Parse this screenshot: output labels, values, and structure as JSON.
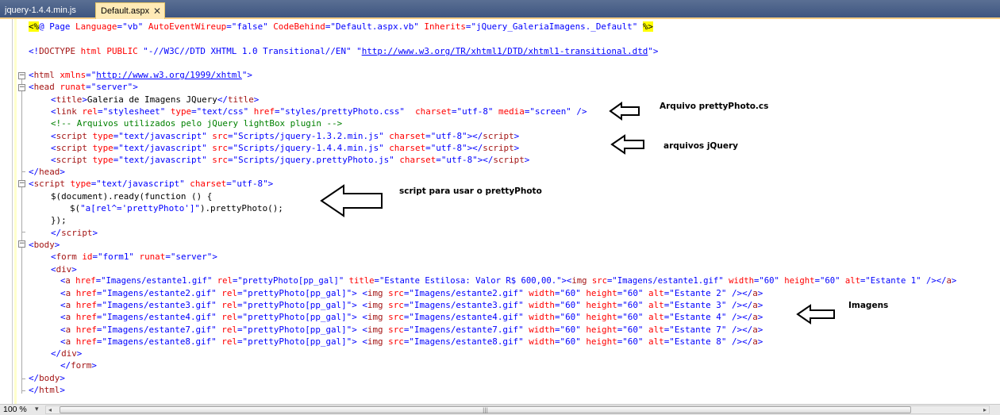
{
  "tabs": [
    {
      "label": "jquery-1.4.4.min.js",
      "active": false
    },
    {
      "label": "Default.aspx",
      "active": true
    }
  ],
  "tab_close_glyph": "✕",
  "code": {
    "l01": {
      "a": "<%",
      "b": "@ Page ",
      "c": "Language",
      "d": "=",
      "e": "\"vb\"",
      "f": " ",
      "g": "AutoEventWireup",
      "h": "=",
      "i": "\"false\"",
      "j": " ",
      "k": "CodeBehind",
      "l": "=",
      "m": "\"Default.aspx.vb\"",
      "n": " ",
      "o": "Inherits",
      "p": "=",
      "q": "\"jQuery_GaleriaImagens._Default\"",
      "r": " ",
      "s": "%>"
    },
    "l02": {
      "a": "<!",
      "b": "DOCTYPE",
      "c": " ",
      "d": "html",
      "e": " ",
      "f": "PUBLIC",
      "g": " \"-//W3C//DTD XHTML 1.0 Transitional//EN\" \"",
      "h": "http://www.w3.org/TR/xhtml1/DTD/xhtml1-transitional.dtd",
      "i": "\">"
    },
    "l03": {
      "a": "<",
      "b": "html",
      "c": " ",
      "d": "xmlns",
      "e": "=\"",
      "f": "http://www.w3.org/1999/xhtml",
      "g": "\">"
    },
    "l04": {
      "a": "<",
      "b": "head",
      "c": " ",
      "d": "runat",
      "e": "=",
      "f": "\"server\"",
      "g": ">"
    },
    "l05": {
      "a": "<",
      "b": "title",
      "c": ">",
      "d": "Galeria de Imagens JQuery",
      "e": "</",
      "f": "title",
      "g": ">"
    },
    "l06": {
      "a": "<",
      "b": "link",
      "c": " ",
      "d": "rel",
      "e": "=",
      "f": "\"stylesheet\"",
      "g": " ",
      "h": "type",
      "i": "=",
      "j": "\"text/css\"",
      "k": " ",
      "l": "href",
      "m": "=",
      "n": "\"styles/prettyPhoto.css\"",
      "o": "  ",
      "p": "charset",
      "q": "=",
      "r": "\"utf-8\"",
      "s": " ",
      "t": "media",
      "u": "=",
      "v": "\"screen\"",
      "w": " />"
    },
    "l07": {
      "a": "<!-- Arquivos utilizados pelo jQuery lightBox plugin -->"
    },
    "l08": {
      "a": "<",
      "b": "script",
      "c": " ",
      "d": "type",
      "e": "=",
      "f": "\"text/javascript\"",
      "g": " ",
      "h": "src",
      "i": "=",
      "j": "\"Scripts/jquery-1.3.2.min.js\"",
      "k": " ",
      "l": "charset",
      "m": "=",
      "n": "\"utf-8\"",
      "o": "></",
      "p": "script",
      "q": ">"
    },
    "l09": {
      "a": "<",
      "b": "script",
      "c": " ",
      "d": "type",
      "e": "=",
      "f": "\"text/javascript\"",
      "g": " ",
      "h": "src",
      "i": "=",
      "j": "\"Scripts/jquery-1.4.4.min.js\"",
      "k": " ",
      "l": "charset",
      "m": "=",
      "n": "\"utf-8\"",
      "o": "></",
      "p": "script",
      "q": ">"
    },
    "l10": {
      "a": "<",
      "b": "script",
      "c": " ",
      "d": "type",
      "e": "=",
      "f": "\"text/javascript\"",
      "g": " ",
      "h": "src",
      "i": "=",
      "j": "\"Scripts/jquery.prettyPhoto.js\"",
      "k": " ",
      "l": "charset",
      "m": "=",
      "n": "\"utf-8\"",
      "o": "></",
      "p": "script",
      "q": ">"
    },
    "l11": {
      "a": "</",
      "b": "head",
      "c": ">"
    },
    "l12": {
      "a": "<",
      "b": "script",
      "c": " ",
      "d": "type",
      "e": "=",
      "f": "\"text/javascript\"",
      "g": " ",
      "h": "charset",
      "i": "=",
      "j": "\"utf-8\"",
      "k": ">"
    },
    "l13": {
      "a": "$(document).ready(function () {"
    },
    "l14": {
      "a": "$(",
      "b": "\"a[rel^='prettyPhoto']\"",
      "c": ").prettyPhoto();"
    },
    "l15": {
      "a": "});"
    },
    "l16": {
      "a": "</",
      "b": "script",
      "c": ">"
    },
    "l17": {
      "a": "<",
      "b": "body",
      "c": ">"
    },
    "l18": {
      "a": "<",
      "b": "form",
      "c": " ",
      "d": "id",
      "e": "=",
      "f": "\"form1\"",
      "g": " ",
      "h": "runat",
      "i": "=",
      "j": "\"server\"",
      "k": ">"
    },
    "l19": {
      "a": "<",
      "b": "div",
      "c": ">"
    },
    "l20": {
      "a": "<",
      "b": "a",
      "c": " ",
      "d": "href",
      "e": "=",
      "f": "\"Imagens/estante1.gif\"",
      "g": " ",
      "h": "rel",
      "i": "=",
      "j": "\"prettyPhoto[pp_gal]\"",
      "k": " ",
      "l": "title",
      "m": "=",
      "n": "\"Estante Estilosa: Valor R$ 600,00.\"",
      "o": "><",
      "p": "img",
      "q": " ",
      "r": "src",
      "s": "=",
      "t": "\"Imagens/estante1.gif\"",
      "u": " ",
      "v": "width",
      "w": "=",
      "x": "\"60\"",
      "y": " ",
      "z": "height",
      "aa": "=",
      "ab": "\"60\"",
      "ac": " ",
      "ad": "alt",
      "ae": "=",
      "af": "\"Estante 1\"",
      "ag": " /></",
      "ah": "a",
      "ai": ">"
    },
    "rows": [
      {
        "href": "\"Imagens/estante2.gif\"",
        "src": "\"Imagens/estante2.gif\"",
        "alt": "\"Estante 2\""
      },
      {
        "href": "\"Imagens/estante3.gif\"",
        "src": "\"Imagens/estante3.gif\"",
        "alt": "\"Estante 3\""
      },
      {
        "href": "\"Imagens/estante4.gif\"",
        "src": "\"Imagens/estante4.gif\"",
        "alt": "\"Estante 4\""
      },
      {
        "href": "\"Imagens/estante7.gif\"",
        "src": "\"Imagens/estante7.gif\"",
        "alt": "\"Estante 7\""
      },
      {
        "href": "\"Imagens/estante8.gif\"",
        "src": "\"Imagens/estante8.gif\"",
        "alt": "\"Estante 8\""
      }
    ],
    "row_tokens": {
      "lt": "<",
      "a": "a",
      "sp": " ",
      "href": "href",
      "eq": "=",
      "rel": "rel",
      "relval": "\"prettyPhoto[pp_gal]\"",
      "close": "> <",
      "img": "img",
      "src": "src",
      "width": "width",
      "sixty": "\"60\"",
      "height": "height",
      "alt": "alt",
      "end1": " /></",
      "gt": ">"
    },
    "l26": {
      "a": "</",
      "b": "div",
      "c": ">"
    },
    "l27": {
      "a": "</",
      "b": "form",
      "c": ">"
    },
    "l28": {
      "a": "</",
      "b": "body",
      "c": ">"
    },
    "l29": {
      "a": "</",
      "b": "html",
      "c": ">"
    }
  },
  "fold_glyph": "−",
  "annotations": {
    "pretty_css": "Arquivo prettyPhoto.cs",
    "jquery_files": "arquivos jQuery",
    "script_usage": "script para usar o prettyPhoto",
    "images": "Imagens"
  },
  "status": {
    "zoom": "100 %",
    "zoom_dropdown": "▾",
    "scroll_left": "◂",
    "scroll_right": "▸",
    "grip": "|||"
  }
}
